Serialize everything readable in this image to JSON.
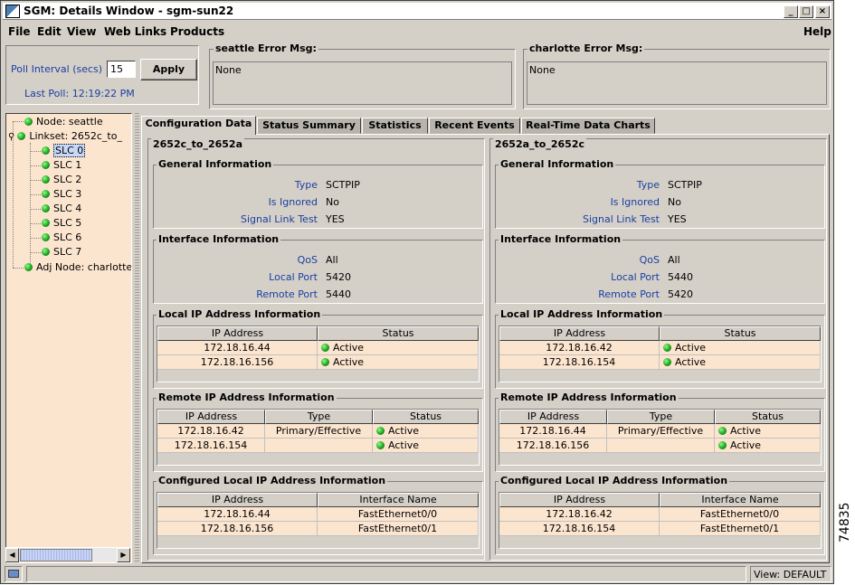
{
  "window": {
    "title": "SGM: Details Window - sgm-sun22"
  },
  "menu": {
    "file": "File",
    "edit": "Edit",
    "view": "View",
    "web_links": "Web Links",
    "products": "Products",
    "help": "Help"
  },
  "poll": {
    "label": "Poll Interval (secs)",
    "value": "15",
    "apply": "Apply",
    "last_poll": "Last Poll:  12:19:22 PM"
  },
  "errors": [
    {
      "title": "seattle  Error Msg:",
      "text": "None"
    },
    {
      "title": "charlotte  Error Msg:",
      "text": "None"
    }
  ],
  "tree": {
    "node": "Node: seattle",
    "linkset": "Linkset: 2652c_to_",
    "slcs": [
      "SLC 0",
      "SLC 1",
      "SLC 2",
      "SLC 3",
      "SLC 4",
      "SLC 5",
      "SLC 6",
      "SLC 7"
    ],
    "adj": "Adj Node: charlotte"
  },
  "tabs": [
    "Configuration Data",
    "Status Summary",
    "Statistics",
    "Recent Events",
    "Real-Time Data Charts"
  ],
  "columns": [
    {
      "title": "2652c_to_2652a",
      "general": {
        "title": "General Information",
        "rows": [
          [
            "Type",
            "SCTPIP"
          ],
          [
            "Is Ignored",
            "No"
          ],
          [
            "Signal Link Test",
            "YES"
          ]
        ]
      },
      "interface": {
        "title": "Interface Information",
        "rows": [
          [
            "QoS",
            "All"
          ],
          [
            "Local Port",
            "5420"
          ],
          [
            "Remote Port",
            "5440"
          ]
        ]
      },
      "local_ip": {
        "title": "Local IP Address Information",
        "headers": [
          "IP Address",
          "Status"
        ],
        "rows": [
          [
            "172.18.16.44",
            "Active"
          ],
          [
            "172.18.16.156",
            "Active"
          ]
        ]
      },
      "remote_ip": {
        "title": "Remote IP Address Information",
        "headers": [
          "IP Address",
          "Type",
          "Status"
        ],
        "rows": [
          [
            "172.18.16.42",
            "Primary/Effective",
            "Active"
          ],
          [
            "172.18.16.154",
            "",
            "Active"
          ]
        ]
      },
      "configured": {
        "title": "Configured Local IP Address Information",
        "headers": [
          "IP Address",
          "Interface Name"
        ],
        "rows": [
          [
            "172.18.16.44",
            "FastEthernet0/0"
          ],
          [
            "172.18.16.156",
            "FastEthernet0/1"
          ]
        ]
      }
    },
    {
      "title": "2652a_to_2652c",
      "general": {
        "title": "General Information",
        "rows": [
          [
            "Type",
            "SCTPIP"
          ],
          [
            "Is Ignored",
            "No"
          ],
          [
            "Signal Link Test",
            "YES"
          ]
        ]
      },
      "interface": {
        "title": "Interface Information",
        "rows": [
          [
            "QoS",
            "All"
          ],
          [
            "Local Port",
            "5440"
          ],
          [
            "Remote Port",
            "5420"
          ]
        ]
      },
      "local_ip": {
        "title": "Local IP Address Information",
        "headers": [
          "IP Address",
          "Status"
        ],
        "rows": [
          [
            "172.18.16.42",
            "Active"
          ],
          [
            "172.18.16.154",
            "Active"
          ]
        ]
      },
      "remote_ip": {
        "title": "Remote IP Address Information",
        "headers": [
          "IP Address",
          "Type",
          "Status"
        ],
        "rows": [
          [
            "172.18.16.44",
            "Primary/Effective",
            "Active"
          ],
          [
            "172.18.16.156",
            "",
            "Active"
          ]
        ]
      },
      "configured": {
        "title": "Configured Local IP Address Information",
        "headers": [
          "IP Address",
          "Interface Name"
        ],
        "rows": [
          [
            "172.18.16.42",
            "FastEthernet0/0"
          ],
          [
            "172.18.16.154",
            "FastEthernet0/1"
          ]
        ]
      }
    }
  ],
  "statusbar": {
    "view": "View: DEFAULT"
  },
  "figure_code": "74835"
}
